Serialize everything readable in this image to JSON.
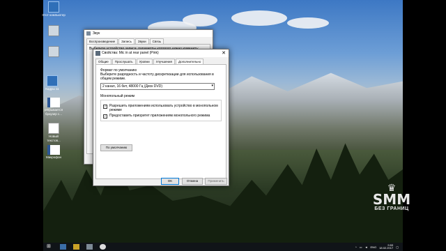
{
  "desktop": {
    "icons": [
      {
        "label": "Этот компьютер",
        "icon": "computer-icon"
      },
      {
        "label": "",
        "icon": "recycle-bin-icon"
      },
      {
        "label": "",
        "icon": "recycle-bin-icon"
      },
      {
        "label": "Кадры 11",
        "icon": "app-icon"
      },
      {
        "label": "открывается браузер с...",
        "icon": "word-doc-icon"
      },
      {
        "label": "Новый текстов...",
        "icon": "text-file-icon"
      },
      {
        "label": "Микрофон",
        "icon": "word-doc-icon"
      }
    ]
  },
  "back_dialog": {
    "title": "Звук",
    "tabs": [
      "Воспроизведение",
      "Запись",
      "Звуки",
      "Связь"
    ],
    "description": "Выберите устройство записи, параметры которого нужно изменить:"
  },
  "front_dialog": {
    "title": "Свойства: Mic in at rear panel (Pink)",
    "close_glyph": "✕",
    "tabs": [
      "Общие",
      "Прослушать",
      "Уровни",
      "Улучшения",
      "Дополнительно"
    ],
    "active_tab": "Дополнительно",
    "default_format_heading": "Формат по умолчанию",
    "default_format_desc": "Выберите разрядность и частоту дискретизации для использования в общем режиме.",
    "format_value": "2 канал, 16 бит, 48000 Гц (Диск DVD)",
    "exclusive_heading": "Монопольный режим",
    "exclusive_options": [
      {
        "label": "Разрешить приложениям использовать устройство в монопольном режиме",
        "checked": true
      },
      {
        "label": "Предоставить приоритет приложениям монопольного режима",
        "checked": true
      }
    ],
    "defaults_button": "По умолчанию",
    "ok_button": "OK",
    "cancel_button": "Отмена",
    "apply_button": "Применить"
  },
  "taskbar": {
    "language": "ENG",
    "time": "9:53",
    "date": "18.02.2017"
  },
  "watermark": {
    "brand": "SMM",
    "tagline": "БЕЗ ГРАНИЦ"
  }
}
